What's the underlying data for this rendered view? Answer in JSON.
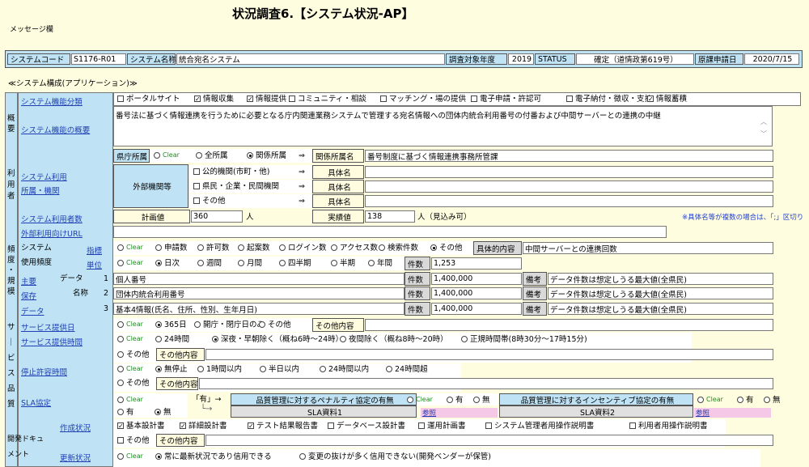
{
  "page_title": "状況調査6.【システム状況-AP】",
  "message_label": "メッセージ欄",
  "header": {
    "sys_code_label": "システムコード",
    "sys_code": "S1176-R01",
    "sys_name_label": "システム名称",
    "sys_name": "統合宛名システム",
    "year_label": "調査対象年度",
    "year": "2019",
    "status_label": "STATUS",
    "status": "確定（道情政第619号）",
    "date_label": "原課申請日",
    "date": "2020/7/15"
  },
  "section_title": "≪システム構成(アプリケーション)≫",
  "kinou": {
    "label": "システム機能分類",
    "options": [
      {
        "label": "ポータルサイト",
        "checked": false
      },
      {
        "label": "情報収集",
        "checked": true
      },
      {
        "label": "情報提供",
        "checked": true
      },
      {
        "label": "コミュニティ・相談",
        "checked": false
      },
      {
        "label": "マッチング・場の提供",
        "checked": false
      },
      {
        "label": "電子申請・許認可",
        "checked": false
      },
      {
        "label": "電子納付・徴収・支払",
        "checked": false
      },
      {
        "label": "情報蓄積",
        "checked": true
      }
    ]
  },
  "gaiyou": {
    "side": "概要",
    "label": "システム機能の概要",
    "text": "番号法に基づく情報連携を行うために必要となる庁内関連業務システムで管理する宛名情報への団体内統合利用番号の付番および中間サーバーとの連携の中継"
  },
  "riyou": {
    "side": "利用者",
    "label1": "システム利用",
    "label2": "所属・機関",
    "kencho_label": "県庁所属",
    "clear": "Clear",
    "zen": "全所属",
    "kankei": "関係所属",
    "arrow": "⇒",
    "kankei_name_label": "関係所属名",
    "kankei_name": "番号制度に基づく情報連携事務所管課",
    "gaibu_label": "外部機関等",
    "gaibu_opts": [
      "公的機関(市町・他)",
      "県民・企業・民間機関",
      "その他"
    ],
    "gutai": "具体名"
  },
  "users": {
    "label": "システム利用者数",
    "plan_label": "計画値",
    "plan": "360",
    "unit": "人",
    "actual_label": "実績値",
    "actual": "138",
    "actual_unit": "人（見込み可）",
    "note": "※具体名等が複数の場合は、「;」区切り"
  },
  "url": {
    "label": "外部利用向けURL",
    "value": ""
  },
  "freq": {
    "side": "頻度",
    "label1": "システム",
    "label2": "使用頻度",
    "index_label": "指標",
    "index_opts": [
      "Clear",
      "申請数",
      "許可数",
      "起案数",
      "ログイン数",
      "アクセス数",
      "検索件数",
      "その他"
    ],
    "detail_label": "具体的内容",
    "detail": "中間サーバーとの連携回数",
    "unit_label": "単位",
    "unit_opts": [
      "Clear",
      "日次",
      "週間",
      "月間",
      "四半期",
      "半期",
      "年間"
    ],
    "count_label": "件数",
    "count": "1,253"
  },
  "scale": {
    "side": "・規模",
    "labels": [
      "主要",
      "保存",
      "データ"
    ],
    "head1": "データ",
    "head2": "名称",
    "rows": [
      {
        "no": "1",
        "name": "個人番号",
        "count": "1,400,000",
        "note": "データ件数は想定しうる最大値(全県民)"
      },
      {
        "no": "2",
        "name": "団体内統合利用番号",
        "count": "1,400,000",
        "note": "データ件数は想定しうる最大値(全県民)"
      },
      {
        "no": "3",
        "name": "基本4情報(氏名、住所、性別、生年月日)",
        "count": "1,400,000",
        "note": "データ件数は想定しうる最大値(全県民)"
      }
    ],
    "count_label": "件数",
    "bikou": "備考"
  },
  "service": {
    "side": "サービス品質",
    "days_label": "サービス提供日",
    "days_opts": [
      "Clear",
      "365日",
      "開庁・閉庁日のみ",
      "その他"
    ],
    "other": "その他内容",
    "time_label": "サービス提供時間",
    "time_opts": [
      "Clear",
      "24時間",
      "深夜・早朝除く（概ね6時～24時）",
      "夜間除く（概ね8時～20時）",
      "正規時間帯(8時30分～17時15分)",
      "その他"
    ],
    "stop_label": "停止許容時間",
    "stop_opts": [
      "Clear",
      "無停止",
      "1時間以内",
      "半日以内",
      "24時間以内",
      "24時間超",
      "その他"
    ],
    "sla_label": "SLA協定",
    "sla_opts": [
      "Clear",
      "有",
      "無"
    ],
    "sla_arrow": "「有」→",
    "sla_src": "SLA資料1",
    "sla_src2": "SLA資料2",
    "penalty": "品質管理に対するペナルティ協定の有無",
    "incentive": "品質管理に対するインセンティブ協定の有無",
    "yes": "有",
    "no": "無",
    "select": "参照"
  },
  "doc": {
    "side": "開発ドキュメント",
    "create_label": "作成状況",
    "create_opts": [
      {
        "label": "基本設計書",
        "checked": true
      },
      {
        "label": "詳細設計書",
        "checked": true
      },
      {
        "label": "テスト結果報告書",
        "checked": true
      },
      {
        "label": "データベース設計書",
        "checked": false
      },
      {
        "label": "運用計画書",
        "checked": false
      },
      {
        "label": "システム管理者用操作説明書",
        "checked": false
      },
      {
        "label": "利用者用操作説明書",
        "checked": false
      },
      {
        "label": "その他",
        "checked": false
      }
    ],
    "other": "その他内容",
    "update_label": "更新状況",
    "update_opts": [
      "Clear",
      "常に最新状況であり信用できる",
      "変更の抜けが多く信用できない(開発ベンダーが保管)"
    ]
  },
  "colors": {
    "label_bg": "#bfe3f5",
    "page_bg": "#fffde0",
    "link": "#1f3fb5",
    "clear": "#1e8c1e"
  }
}
